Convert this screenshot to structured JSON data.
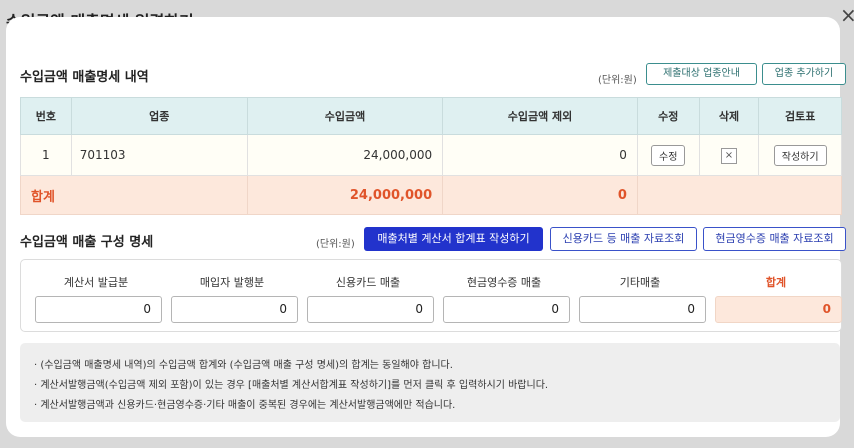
{
  "dialog": {
    "title": "수입금액 매출명세 입력하기",
    "close_glyph": "×"
  },
  "detail_section": {
    "title": "수입금액 매출명세 내역",
    "unit": "(단위:원)",
    "guide_button": "제출대상 업종안내",
    "add_button": "업종 추가하기",
    "columns": [
      "번호",
      "업종",
      "수입금액",
      "수입금액 제외",
      "수정",
      "삭제",
      "검토표"
    ],
    "rows": [
      {
        "no": "1",
        "industry": "701103",
        "amount": "24,000,000",
        "excluded": "0",
        "edit": "수정",
        "delete": "×",
        "review": "작성하기"
      }
    ],
    "total": {
      "label": "합계",
      "amount": "24,000,000",
      "excluded": "0"
    }
  },
  "composition_section": {
    "title": "수입금액 매출 구성 명세",
    "unit": "(단위:원)",
    "invoice_button": "매출처별 계산서 합계표 작성하기",
    "card_button": "신용카드 등 매출 자료조회",
    "cash_button": "현금영수증 매출 자료조회",
    "fields": [
      {
        "label": "계산서 발급분",
        "value": "0"
      },
      {
        "label": "매입자 발행분",
        "value": "0"
      },
      {
        "label": "신용카드 매출",
        "value": "0"
      },
      {
        "label": "현금영수증 매출",
        "value": "0"
      },
      {
        "label": "기타매출",
        "value": "0"
      },
      {
        "label": "합계",
        "value": "0"
      }
    ]
  },
  "notes": [
    "· (수입금액 매출명세 내역)의 수입금액 합계와 (수입금액 매출 구성 명세)의 합계는 동일해야 합니다.",
    "· 계산서발행금액(수입금액 제외 포함)이 있는 경우 [매출처별 계산서합계표 작성하기]를 먼저 클릭 후 입력하시기 바랍니다.",
    "· 계산서발행금액과 신용카드·현금영수증·기타 매출이 중복된 경우에는 계산서발행금액에만 적습니다."
  ],
  "colors": {
    "accent_teal": "#3b8e8e",
    "primary_blue": "#2233cc",
    "total_orange": "#e0542a",
    "total_bg": "#fde8dc"
  }
}
